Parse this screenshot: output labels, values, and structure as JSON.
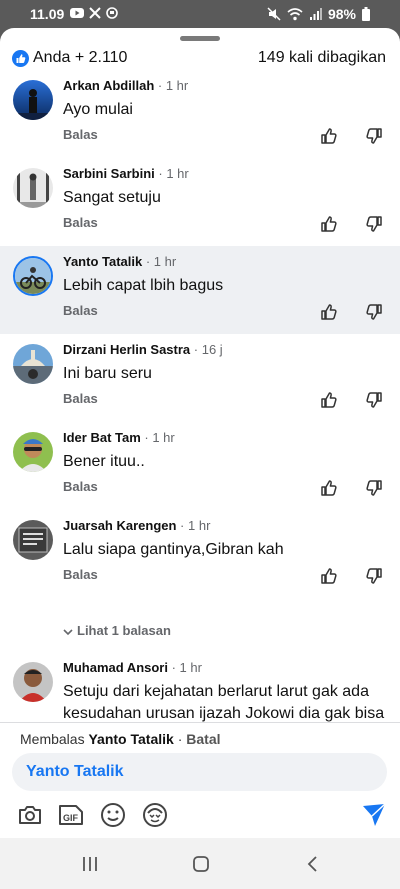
{
  "status": {
    "time": "11.09",
    "battery": "98%",
    "icons": [
      "youtube-icon",
      "x-icon",
      "circle-status-icon"
    ],
    "right_icons": [
      "mute-icon",
      "wifi-icon",
      "signal-icon",
      "battery-icon"
    ]
  },
  "header": {
    "reactions": "Anda + 2.110",
    "shares": "149 kali dibagikan"
  },
  "comments": [
    {
      "name": "Arkan Abdillah",
      "time": "1 hr",
      "text": "Ayo mulai",
      "reply": "Balas"
    },
    {
      "name": "Sarbini Sarbini",
      "time": "1 hr",
      "text": "Sangat setuju",
      "reply": "Balas"
    },
    {
      "name": "Yanto Tatalik",
      "time": "1 hr",
      "text": "Lebih capat lbih bagus",
      "reply": "Balas"
    },
    {
      "name": "Dirzani Herlin Sastra",
      "time": "16 j",
      "text": "Ini baru seru",
      "reply": "Balas"
    },
    {
      "name": "Ider Bat Tam",
      "time": "1 hr",
      "text": "Bener ituu..",
      "reply": "Balas"
    },
    {
      "name": "Juarsah Karengen",
      "time": "1 hr",
      "text": "Lalu siapa gantinya,Gibran kah",
      "reply": "Balas"
    },
    {
      "name": "Muhamad Ansori",
      "time": "1 hr",
      "text": "Setuju dari kejahatan berlarut larut gak ada kesudahan urusan ijazah Jokowi dia gak bisa tegas mbg tetap juga gak ada ketegasan ... dalam ..."
    }
  ],
  "view_replies": "Lihat 1 balasan",
  "composer": {
    "replying_prefix": "Membalas",
    "replying_to": "Yanto Tatalik",
    "separator": "·",
    "cancel": "Batal",
    "input_value": "Yanto Tatalik",
    "gif_label": "GIF"
  },
  "colors": {
    "accent": "#1877f2",
    "highlight": "#eef0f3"
  }
}
